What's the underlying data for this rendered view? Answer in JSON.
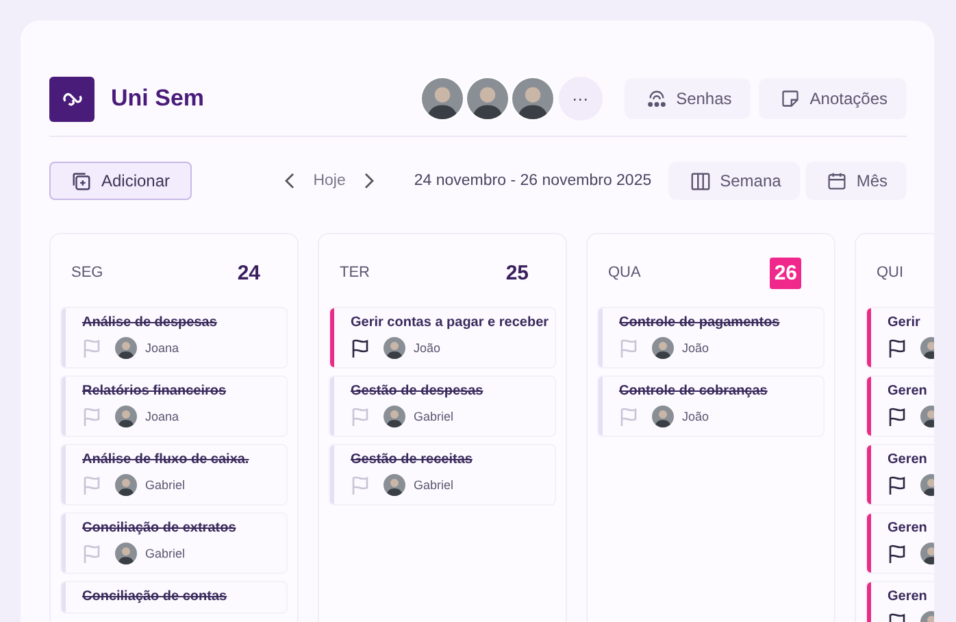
{
  "app": {
    "name": "Uni Sem"
  },
  "header": {
    "more_label": "···",
    "buttons": [
      {
        "kind": "passwords",
        "label": "Senhas"
      },
      {
        "kind": "notes",
        "label": "Anotações"
      }
    ]
  },
  "toolbar": {
    "add_label": "Adicionar",
    "today_label": "Hoje",
    "range": "24 novembro - 26 novembro 2025",
    "views": [
      {
        "kind": "week",
        "label": "Semana"
      },
      {
        "kind": "month",
        "label": "Mês"
      }
    ]
  },
  "days": [
    {
      "label": "SEG",
      "number": "24",
      "today": false,
      "tasks": [
        {
          "title": "Análise de despesas",
          "done": true,
          "assignee": "Joana"
        },
        {
          "title": "Relatórios financeiros",
          "done": true,
          "assignee": "Joana"
        },
        {
          "title": "Análise de fluxo de caixa.",
          "done": true,
          "assignee": "Gabriel"
        },
        {
          "title": "Conciliação de extratos",
          "done": true,
          "assignee": "Gabriel"
        },
        {
          "title": "Conciliação de contas",
          "done": true
        }
      ]
    },
    {
      "label": "TER",
      "number": "25",
      "today": false,
      "tasks": [
        {
          "title": "Gerir contas a pagar e receber",
          "done": false,
          "assignee": "João"
        },
        {
          "title": "Gestão de despesas",
          "done": true,
          "assignee": "Gabriel"
        },
        {
          "title": "Gestão de receitas",
          "done": true,
          "assignee": "Gabriel"
        }
      ]
    },
    {
      "label": "QUA",
      "number": "26",
      "today": true,
      "tasks": [
        {
          "title": "Controle de pagamentos",
          "done": true,
          "assignee": "João"
        },
        {
          "title": "Controle de cobranças",
          "done": true,
          "assignee": "João"
        }
      ]
    },
    {
      "label": "QUI",
      "tasks": [
        {
          "title": "Gerir",
          "done": false
        },
        {
          "title": "Geren",
          "done": false
        },
        {
          "title": "Geren",
          "done": false
        },
        {
          "title": "Geren",
          "done": false
        },
        {
          "title": "Geren",
          "done": false
        }
      ]
    }
  ]
}
